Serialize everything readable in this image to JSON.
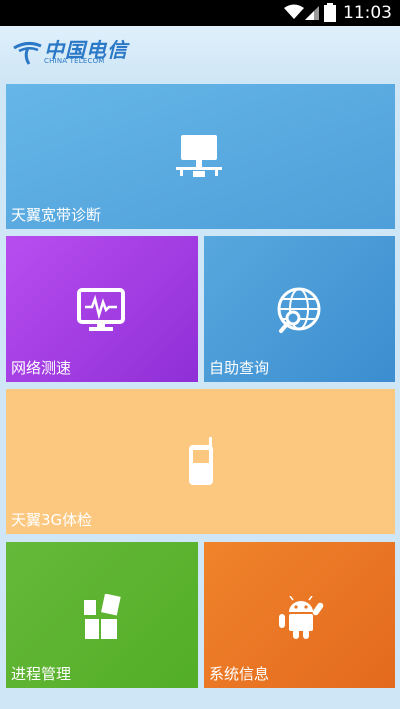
{
  "status_bar": {
    "time": "11:03"
  },
  "brand": {
    "name_cn": "中国电信",
    "name_en": "CHINA TELECOM"
  },
  "tiles": [
    {
      "label": "天翼宽带诊断",
      "icon": "network-computer-icon",
      "color": "#5aaae2"
    },
    {
      "label": "网络测速",
      "icon": "monitor-speed-icon",
      "color": "#a83ee6"
    },
    {
      "label": "自助查询",
      "icon": "globe-search-icon",
      "color": "#4a9ad6"
    },
    {
      "label": "天翼3G体检",
      "icon": "mobile-phone-icon",
      "color": "#fcc77f"
    },
    {
      "label": "进程管理",
      "icon": "process-blocks-icon",
      "color": "#5cb330"
    },
    {
      "label": "系统信息",
      "icon": "android-icon",
      "color": "#ea7625"
    }
  ]
}
